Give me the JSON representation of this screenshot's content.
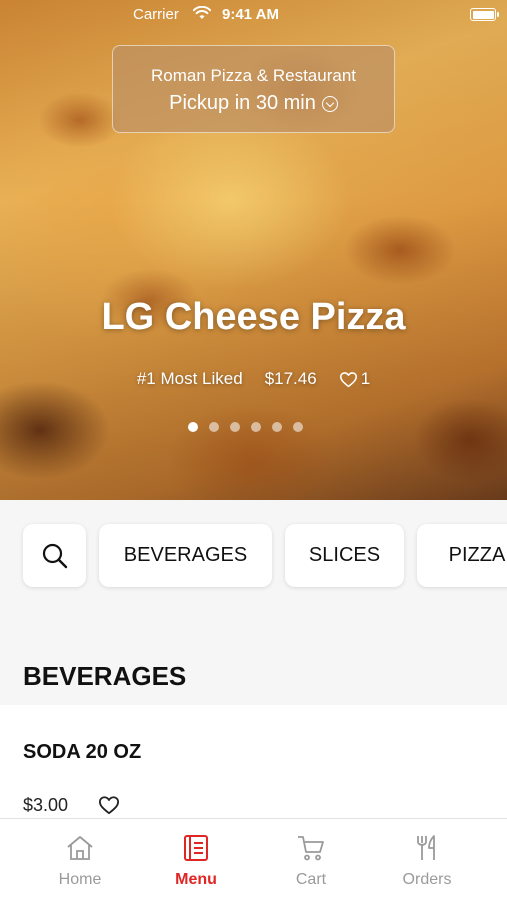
{
  "status_bar": {
    "carrier": "Carrier",
    "time": "9:41 AM"
  },
  "restaurant": {
    "name": "Roman Pizza & Restaurant",
    "pickup_text": "Pickup in 30 min"
  },
  "featured": {
    "title": "LG Cheese Pizza",
    "rank": "#1 Most Liked",
    "price": "$17.46",
    "likes": "1",
    "carousel_pages": 6,
    "carousel_active": 0
  },
  "categories": [
    "BEVERAGES",
    "SLICES",
    "PIZZA"
  ],
  "section": {
    "title": "BEVERAGES"
  },
  "items": [
    {
      "name": "SODA 20 OZ",
      "price": "$3.00"
    }
  ],
  "tabs": [
    {
      "label": "Home",
      "icon": "home-icon",
      "active": false
    },
    {
      "label": "Menu",
      "icon": "menu-icon",
      "active": true
    },
    {
      "label": "Cart",
      "icon": "cart-icon",
      "active": false
    },
    {
      "label": "Orders",
      "icon": "orders-icon",
      "active": false
    }
  ],
  "colors": {
    "accent": "#e02525",
    "inactive_tab": "#9a9a9a",
    "background": "#f6f6f6"
  }
}
